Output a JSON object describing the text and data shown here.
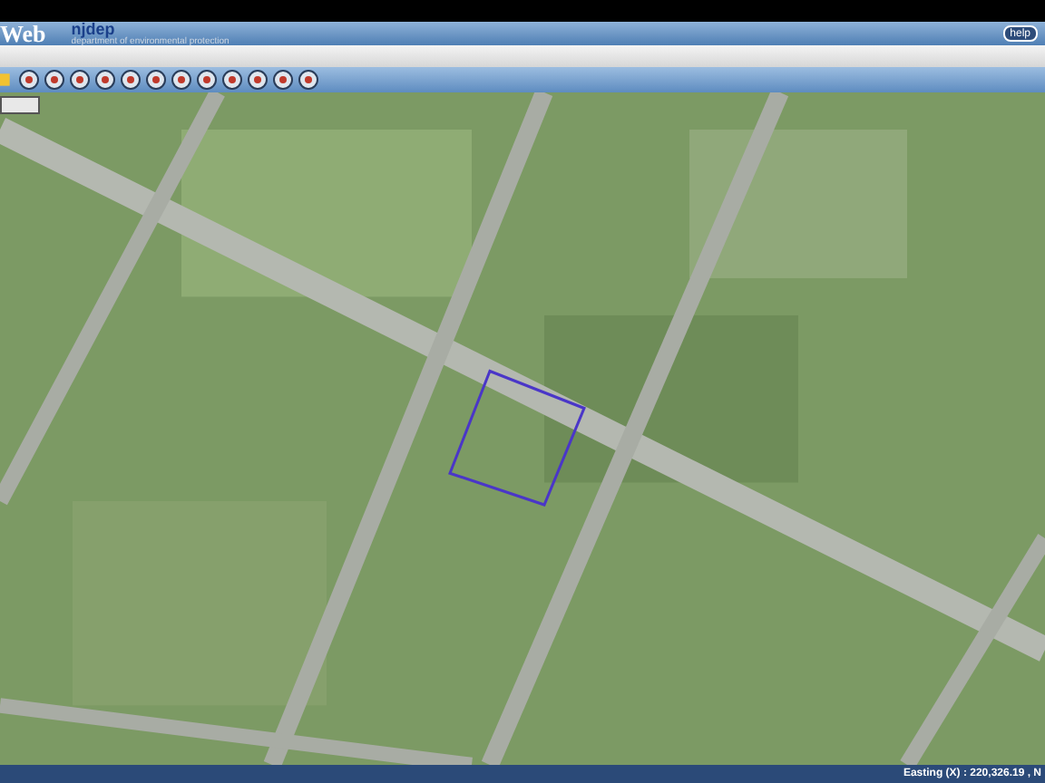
{
  "header": {
    "app_title": "Web",
    "logo": "njdep",
    "subtitle": "department of environmental protection",
    "help_button": "help"
  },
  "status_bar": {
    "coordinates": "Easting (X) : 220,326.19 , N"
  }
}
